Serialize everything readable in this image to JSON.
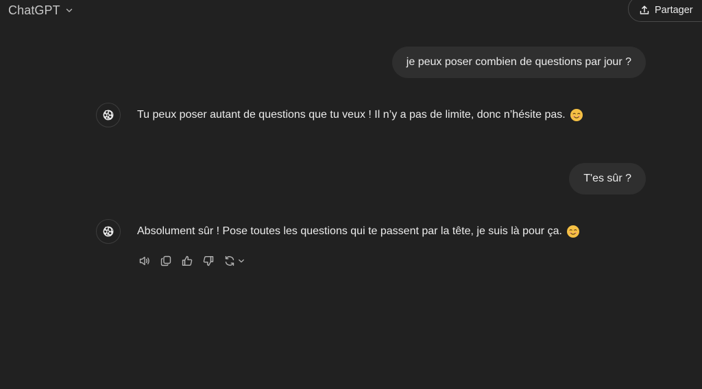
{
  "header": {
    "model_name": "ChatGPT",
    "model_dropdown_icon": "chevron-down-icon",
    "share_label": "Partager",
    "share_icon": "upload-icon"
  },
  "conversation": [
    {
      "role": "user",
      "text": "je peux poser combien de questions par jour ?"
    },
    {
      "role": "assistant",
      "avatar_icon": "openai-logo-icon",
      "text": "Tu peux poser autant de questions que tu veux ! Il n’y a pas de limite, donc n’hésite pas.",
      "emoji": "smiling-face-emoji"
    },
    {
      "role": "user",
      "text": "T'es sûr ?"
    },
    {
      "role": "assistant",
      "avatar_icon": "openai-logo-icon",
      "text": "Absolument sûr ! Pose toutes les questions qui te passent par la tête, je suis là pour ça.",
      "emoji": "smiling-face-emoji"
    }
  ],
  "message_actions": [
    "speaker-icon",
    "copy-icon",
    "thumbs-up-icon",
    "thumbs-down-icon",
    "regenerate-icon",
    "chevron-down-icon"
  ],
  "colors": {
    "background": "#212121",
    "user_bubble": "#2f2f2f",
    "text": "#ececec",
    "muted": "#b4b4b4"
  }
}
